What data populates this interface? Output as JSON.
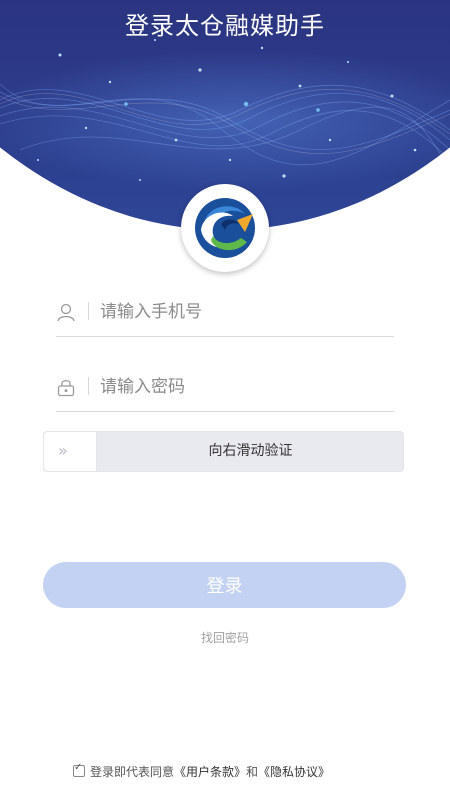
{
  "header": {
    "title": "登录太仓融媒助手"
  },
  "form": {
    "phone_placeholder": "请输入手机号",
    "password_placeholder": "请输入密码",
    "slider_text": "向右滑动验证",
    "slider_handle_glyph": "»",
    "login_label": "登录",
    "forgot_label": "找回密码"
  },
  "agreement": {
    "checked": true,
    "checkmark": "✓",
    "prefix": "登录即代表同意",
    "terms_link": "《用户条款》",
    "conjunction": "和",
    "privacy_link": "《隐私协议》"
  },
  "colors": {
    "banner": "#262a6c",
    "login_button": "#c3d2f2",
    "slider_bg": "#e9e9f0"
  },
  "icons": {
    "phone_field": "user-icon",
    "password_field": "lock-icon",
    "slider": "double-chevron-right-icon"
  }
}
